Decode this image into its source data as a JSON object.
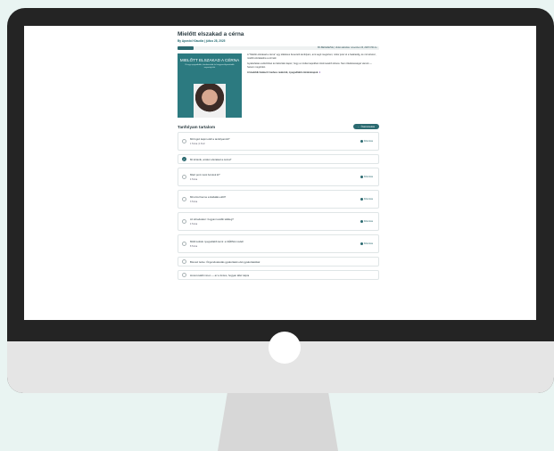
{
  "course": {
    "title": "Mielőtt elszakad a cérna",
    "author_line": "By Apostol Klaudia | július 28, 2025",
    "progress_percent": 8,
    "progress_text": "8% BEFEJEZVE | Utolsó aktivitás: november 26, 2025 6:50 du."
  },
  "cover": {
    "title": "MIELŐTT ELSZAKAD A CÉRNA",
    "subtitle": "Út egy nyugodtabb, türelmesebb és kiegyensúlyozottabb anyaság felé"
  },
  "intro": {
    "p1": "A \"Mielőtt elszakad a cérna\" egy tökéletes bevezető tanfolyam, ami segít megérteni, mikor jutsz el a határaidig, és mit tehetsz, mielőtt elszakadna a cérnád.",
    "p2": "Gyakorlatias eszközöket és bátorítást kapsz, hogy a mindennapokban türelmesebb lehess. Nem tökéletességet várunk — hanem megértést.",
    "p3": "A kisebbik hatásért: kedves reakciók, nyugodtabb mindennapok."
  },
  "section": {
    "title": "Tanfolyam tartalom",
    "collapse_label": "Összecsukás"
  },
  "lessons": [
    {
      "title": "Mit fogsz kapni ettől a tanfolyamtól?",
      "meta": "1 Téma  |  1 Kvíz",
      "expand": "Kibontás",
      "done": false,
      "tall": true
    },
    {
      "title": "Mi történik, amikor elszakad a cérna?",
      "meta": "",
      "expand": "",
      "done": true,
      "tall": false
    },
    {
      "title": "Miért pont most borulok ki?",
      "meta": "4 Téma",
      "expand": "Kibontás",
      "done": false,
      "tall": true
    },
    {
      "title": "Mit érzel benne a kiabálás előtt?",
      "meta": "3 Téma",
      "expand": "Kibontás",
      "done": false,
      "tall": true
    },
    {
      "title": "Az ébredéskor: hogyan tovább lelkileg?",
      "meta": "4 Téma",
      "expand": "Kibontás",
      "done": false,
      "tall": true
    },
    {
      "title": "Mitől tudnék nyugodtabb lenni: a CÉRNA modell",
      "meta": "8 Téma",
      "expand": "Kibontás",
      "done": false,
      "tall": true
    },
    {
      "title": "Bónusz lecke: Öngondoskodás gyakorlatok első gyakorlatokkal",
      "meta": "",
      "expand": "",
      "done": false,
      "tall": false
    },
    {
      "title": "Hová tovább innen — az a fontos, hogyan állsz talpra",
      "meta": "",
      "expand": "",
      "done": false,
      "tall": false
    }
  ]
}
